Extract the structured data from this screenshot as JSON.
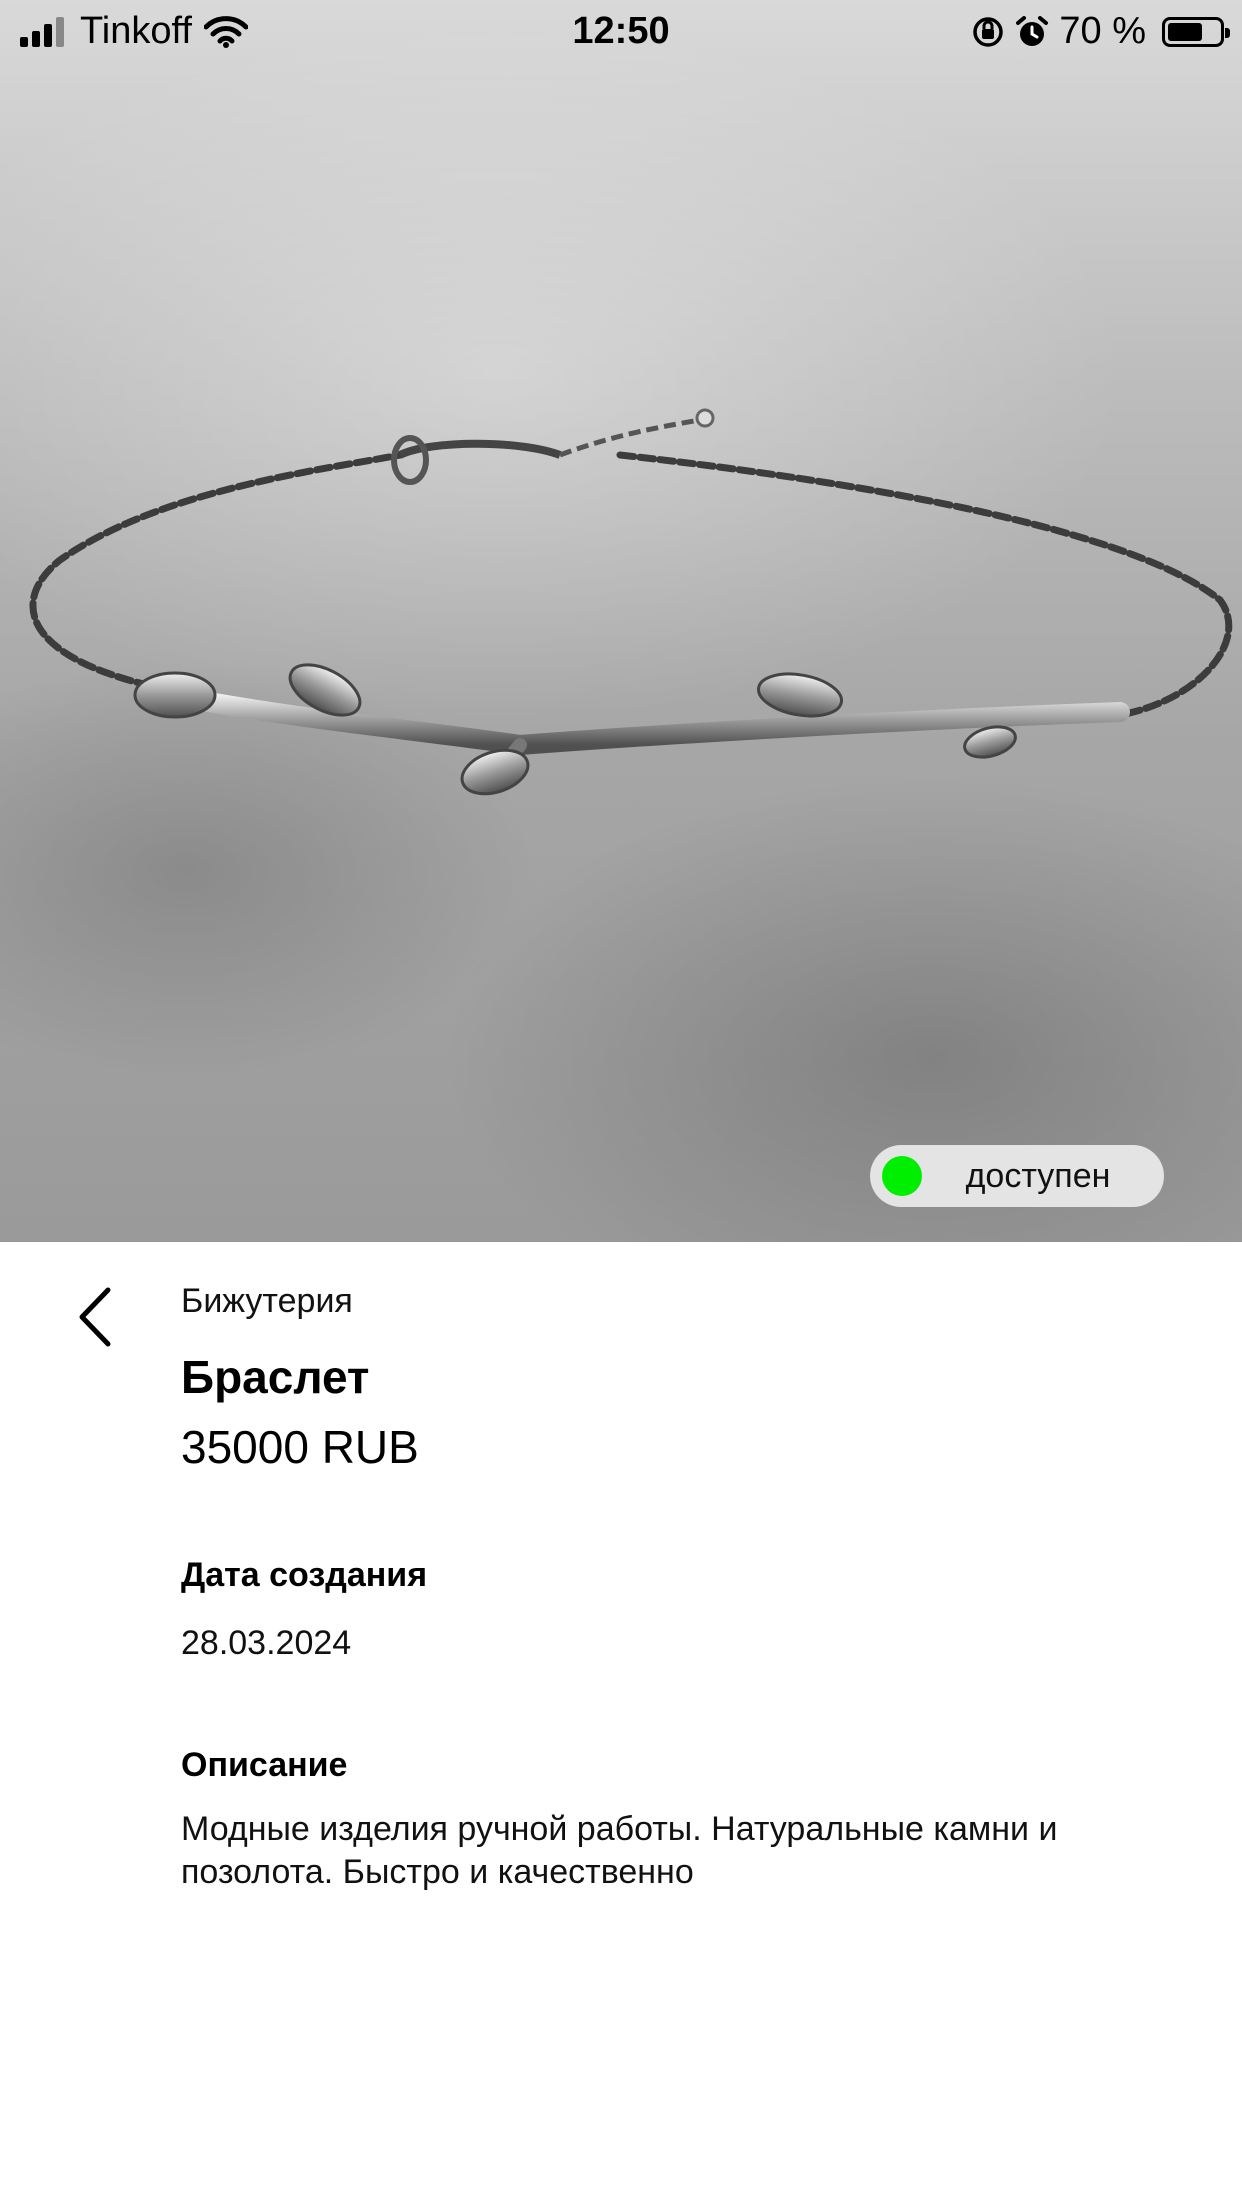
{
  "status_bar": {
    "carrier": "Tinkoff",
    "time": "12:50",
    "battery_percent": "70 %",
    "battery_level": 0.7,
    "icons": [
      "signal-icon",
      "wifi-icon",
      "orientation-lock-icon",
      "alarm-icon",
      "battery-icon"
    ]
  },
  "hero": {
    "image": "bracelet-photo",
    "status_badge": {
      "label": "доступен",
      "dot_color": "#00ee00"
    }
  },
  "product": {
    "category": "Бижутерия",
    "title": "Браслет",
    "price": "35000 RUB",
    "date_label": "Дата создания",
    "date_value": "28.03.2024",
    "description_label": "Описание",
    "description": "Модные изделия ручной работы. Натуральные камни и позолота. Быстро и качественно"
  },
  "navigation": {
    "back_icon": "chevron-left-icon"
  }
}
